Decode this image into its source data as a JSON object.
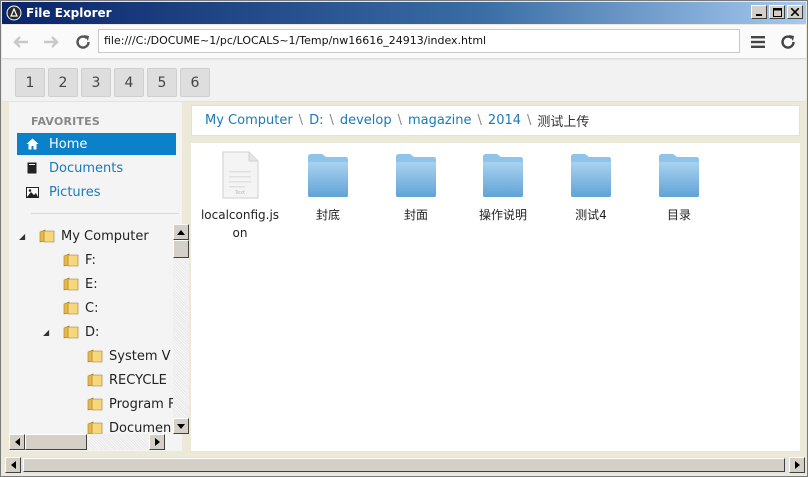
{
  "window": {
    "title": "File Explorer"
  },
  "address": {
    "url": "file:///C:/DOCUME~1/pc/LOCALS~1/Temp/nw16616_24913/index.html"
  },
  "tabs": [
    "1",
    "2",
    "3",
    "4",
    "5",
    "6"
  ],
  "favorites": {
    "title": "FAVORITES",
    "items": [
      {
        "label": "Home",
        "icon": "home-icon",
        "active": true
      },
      {
        "label": "Documents",
        "icon": "document-icon",
        "active": false
      },
      {
        "label": "Pictures",
        "icon": "picture-icon",
        "active": false
      }
    ]
  },
  "tree": {
    "items": [
      {
        "label": "My Computer",
        "toggle": "◢",
        "depth": 0
      },
      {
        "label": "F:",
        "toggle": "",
        "depth": 1
      },
      {
        "label": "E:",
        "toggle": "",
        "depth": 1
      },
      {
        "label": "C:",
        "toggle": "",
        "depth": 1
      },
      {
        "label": "D:",
        "toggle": "◢",
        "depth": 1
      },
      {
        "label": "System V",
        "toggle": "",
        "depth": 2
      },
      {
        "label": "RECYCLE",
        "toggle": "",
        "depth": 2
      },
      {
        "label": "Program F",
        "toggle": "",
        "depth": 2
      },
      {
        "label": "Documen",
        "toggle": "",
        "depth": 2
      }
    ]
  },
  "breadcrumb": {
    "links": [
      "My Computer",
      "D:",
      "develop",
      "magazine",
      "2014"
    ],
    "separator": "\\",
    "current": "测试上传"
  },
  "files": [
    {
      "name": "localconfig.json",
      "type": "file"
    },
    {
      "name": "封底",
      "type": "folder"
    },
    {
      "name": "封面",
      "type": "folder"
    },
    {
      "name": "操作说明",
      "type": "folder"
    },
    {
      "name": "测试4",
      "type": "folder"
    },
    {
      "name": "目录",
      "type": "folder"
    }
  ],
  "colors": {
    "accent": "#0a81c8",
    "link": "#1a7ab8",
    "folder": "#7fb8e0"
  }
}
